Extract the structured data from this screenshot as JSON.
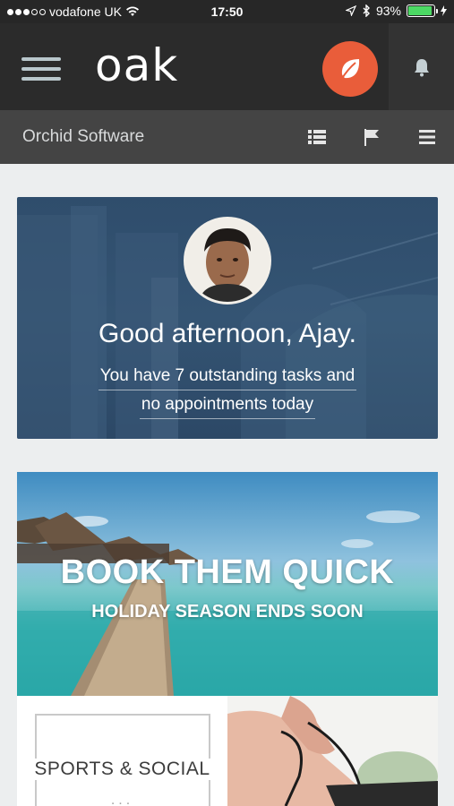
{
  "status_bar": {
    "carrier": "vodafone UK",
    "time": "17:50",
    "battery": "93%",
    "battery_level": 0.93
  },
  "header": {
    "logo": "oak",
    "menu_icon": "hamburger-icon",
    "action_icon": "leaf-icon",
    "notification_icon": "bell-icon"
  },
  "subheader": {
    "organization": "Orchid Software",
    "icons": [
      "list-view-icon",
      "flag-icon",
      "menu-icon"
    ]
  },
  "welcome": {
    "greeting": "Good afternoon, Ajay.",
    "tasks_line1": "You have 7 outstanding tasks and",
    "tasks_line2": "no appointments today"
  },
  "promo": {
    "title": "BOOK THEM QUICK",
    "subtitle": "HOLIDAY SEASON ENDS SOON"
  },
  "tiles": {
    "sports_label": "SPORTS & SOCIAL",
    "sports_dots": "..."
  },
  "colors": {
    "accent": "#e95d3a",
    "header_bg": "#2b2b2b",
    "subheader_bg": "#444444",
    "battery_green": "#4cd964"
  }
}
